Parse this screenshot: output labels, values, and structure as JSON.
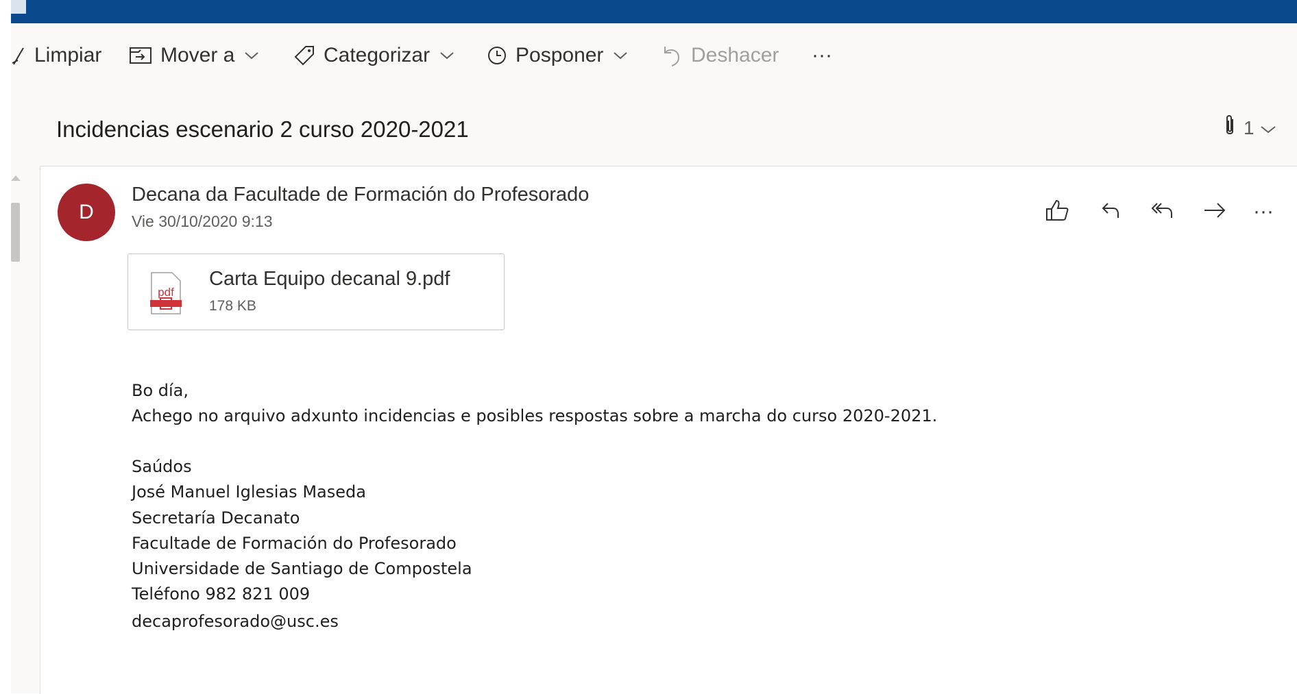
{
  "toolbar": {
    "sweep_label": "Limpiar",
    "move_label": "Mover a",
    "categorize_label": "Categorizar",
    "snooze_label": "Posponer",
    "undo_label": "Deshacer",
    "more_label": "···"
  },
  "message": {
    "subject": "Incidencias escenario 2 curso 2020-2021",
    "attachment_count": "1",
    "avatar_initial": "D",
    "sender": "Decana da Facultade de Formación do Profesorado",
    "date": "Vie 30/10/2020 9:13",
    "attachment": {
      "name": "Carta Equipo decanal 9.pdf",
      "size": "178 KB",
      "type_label": "pdf"
    },
    "body_lines": [
      "Bo día,",
      "Achego no arquivo adxunto incidencias e posibles respostas sobre a marcha do curso 2020-2021.",
      "",
      "Saúdos",
      "José Manuel Iglesias Maseda",
      "Secretaría Decanato",
      "Facultade de Formación do Profesorado",
      "Universidade de Santiago de Compostela",
      "Teléfono 982 821 009",
      "decaprofesorado@usc.es"
    ],
    "actions_more": "···"
  },
  "colors": {
    "header": "#0a4a8c",
    "avatar": "#a4262c",
    "pdf": "#d13438"
  }
}
